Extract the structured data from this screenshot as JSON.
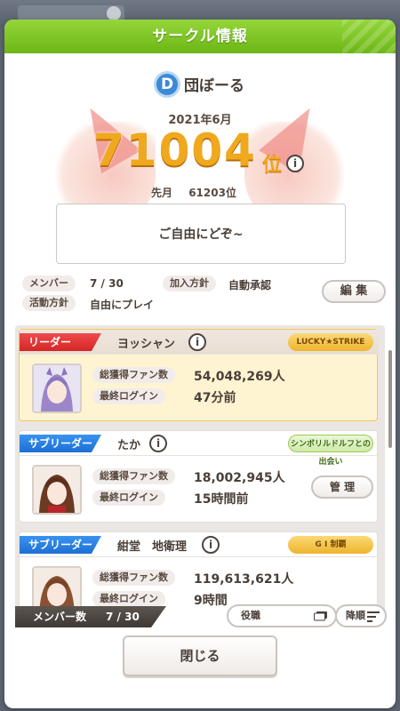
{
  "dialog": {
    "title": "サークル情報",
    "circle_name": "団ぼーる",
    "emblem_letter": "D",
    "rank_month": "2021年6月",
    "rank_number": "71004",
    "rank_suffix": "位",
    "info_icon": "i",
    "prev_month_label": "先月",
    "prev_month_value": "61203位",
    "message": "ご自由にどぞ~",
    "members_label": "メンバー",
    "members_value": "7 / 30",
    "join_policy_label": "加入方針",
    "join_policy_value": "自動承認",
    "activity_label": "活動方針",
    "activity_value": "自由にプレイ",
    "edit_label": "編 集"
  },
  "stat_labels": {
    "fans": "総獲得ファン数",
    "last_login": "最終ログイン"
  },
  "members": [
    {
      "role": "リーダー",
      "name": "ヨッシャン",
      "fans": "54,048,269人",
      "last_login": "47分前",
      "badge": "LUCKY★STRIKE"
    },
    {
      "role": "サブリーダー",
      "name": "たか",
      "fans": "18,002,945人",
      "last_login": "15時間前",
      "badge": "シンボリルドルフとの出会い",
      "manage_label": "管 理"
    },
    {
      "role": "サブリーダー",
      "name": "紺堂　地衛理",
      "fans": "119,613,621人",
      "last_login": "9時間",
      "badge": "G I 制覇"
    }
  ],
  "bottom_bar": {
    "member_count_label": "メンバー数",
    "member_count_value": "7 / 30",
    "role_filter_label": "役職",
    "sort_label": "降順"
  },
  "close_label": "閉じる",
  "colors": {
    "header_green": "#7cc62a",
    "rank_gold": "#f0a81e",
    "leader_red": "#d52626",
    "subleader_blue": "#1d6fd4"
  }
}
